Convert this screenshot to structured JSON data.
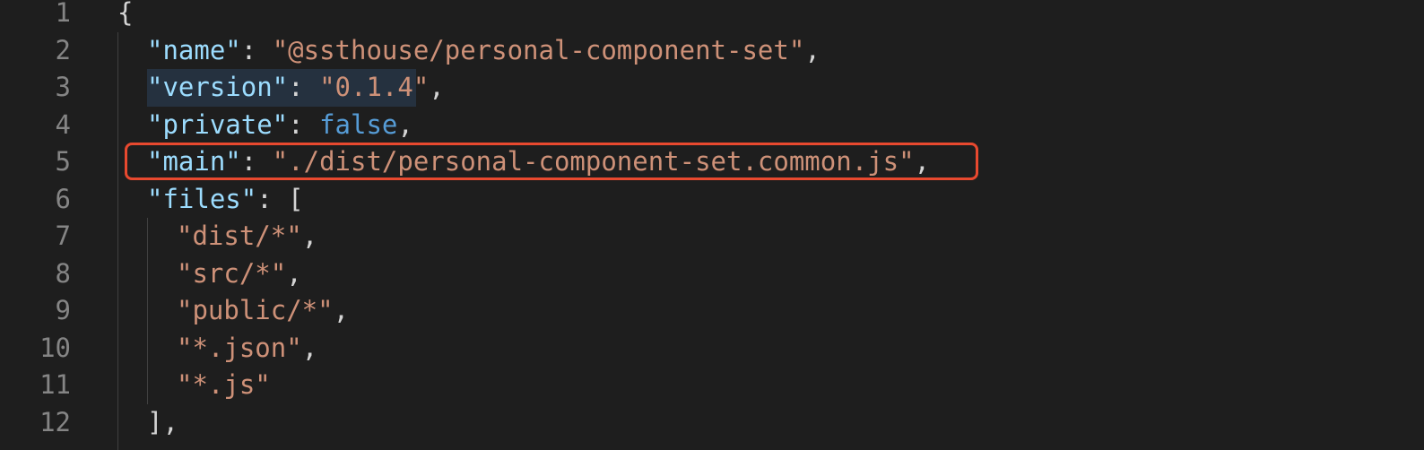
{
  "editor": {
    "lines": [
      {
        "num": "1",
        "indent": 0,
        "parts": [
          {
            "t": "{",
            "c": "punct"
          }
        ]
      },
      {
        "num": "2",
        "indent": 1,
        "parts": [
          {
            "t": "\"name\"",
            "c": "key"
          },
          {
            "t": ": ",
            "c": "punct"
          },
          {
            "t": "\"@ssthouse/personal-component-set\"",
            "c": "str"
          },
          {
            "t": ",",
            "c": "punct"
          }
        ]
      },
      {
        "num": "3",
        "indent": 1,
        "highlight": true,
        "parts": [
          {
            "t": "\"version\"",
            "c": "key"
          },
          {
            "t": ": ",
            "c": "punct"
          },
          {
            "t": "\"0.1.4\"",
            "c": "str"
          },
          {
            "t": ",",
            "c": "punct"
          }
        ]
      },
      {
        "num": "4",
        "indent": 1,
        "parts": [
          {
            "t": "\"private\"",
            "c": "key"
          },
          {
            "t": ": ",
            "c": "punct"
          },
          {
            "t": "false",
            "c": "kw"
          },
          {
            "t": ",",
            "c": "punct"
          }
        ]
      },
      {
        "num": "5",
        "indent": 1,
        "parts": [
          {
            "t": "\"main\"",
            "c": "key"
          },
          {
            "t": ": ",
            "c": "punct"
          },
          {
            "t": "\"./dist/personal-component-set.common.js\"",
            "c": "str"
          },
          {
            "t": ",",
            "c": "punct"
          }
        ]
      },
      {
        "num": "6",
        "indent": 1,
        "parts": [
          {
            "t": "\"files\"",
            "c": "key"
          },
          {
            "t": ": [",
            "c": "punct"
          }
        ]
      },
      {
        "num": "7",
        "indent": 2,
        "parts": [
          {
            "t": "\"dist/*\"",
            "c": "str"
          },
          {
            "t": ",",
            "c": "punct"
          }
        ]
      },
      {
        "num": "8",
        "indent": 2,
        "parts": [
          {
            "t": "\"src/*\"",
            "c": "str"
          },
          {
            "t": ",",
            "c": "punct"
          }
        ]
      },
      {
        "num": "9",
        "indent": 2,
        "parts": [
          {
            "t": "\"public/*\"",
            "c": "str"
          },
          {
            "t": ",",
            "c": "punct"
          }
        ]
      },
      {
        "num": "10",
        "indent": 2,
        "parts": [
          {
            "t": "\"*.json\"",
            "c": "str"
          },
          {
            "t": ",",
            "c": "punct"
          }
        ]
      },
      {
        "num": "11",
        "indent": 2,
        "parts": [
          {
            "t": "\"*.js\"",
            "c": "str"
          }
        ]
      },
      {
        "num": "12",
        "indent": 1,
        "parts": [
          {
            "t": "],",
            "c": "punct"
          }
        ]
      }
    ],
    "colors": {
      "background": "#1e1e1e",
      "line_number": "#858585",
      "key": "#9cdcfe",
      "string": "#ce9178",
      "keyword": "#569cd6",
      "punctuation": "#d4d4d4",
      "highlight_box": "#e8492f"
    }
  }
}
